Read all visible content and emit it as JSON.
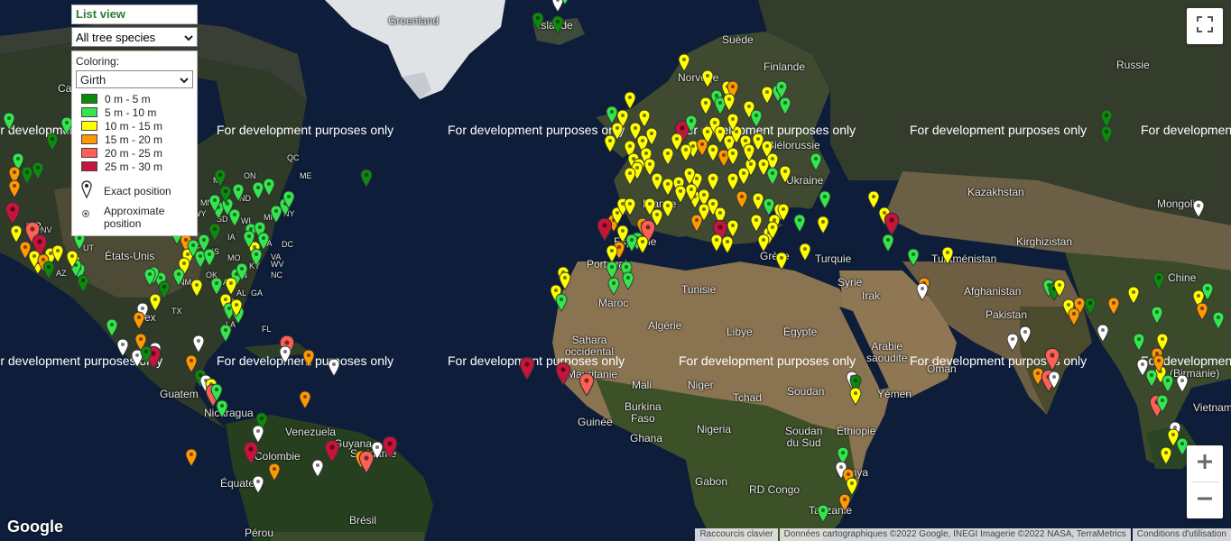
{
  "panel": {
    "list_view": "List view",
    "species_selected": "All tree species",
    "coloring_label": "Coloring:",
    "coloring_selected": "Girth",
    "legend": [
      {
        "label": "0 m - 5 m",
        "color": "#0b8a0b"
      },
      {
        "label": "5 m - 10 m",
        "color": "#33e64d"
      },
      {
        "label": "10 m - 15 m",
        "color": "#ffff00"
      },
      {
        "label": "15 m - 20 m",
        "color": "#ff9900"
      },
      {
        "label": "20 m - 25 m",
        "color": "#ff6055"
      },
      {
        "label": "25 m - 30 m",
        "color": "#c8143c"
      }
    ],
    "exact_position": "Exact position",
    "approx_position": "Approximate position"
  },
  "watermark": "For development purposes only",
  "places": {
    "groenland": "Groenland",
    "islande": "Islande",
    "suede": "Suède",
    "finlande": "Finlande",
    "norvege": "Norvège",
    "russie": "Russie",
    "bielorussie": "Biélorussie",
    "ukraine": "Ukraine",
    "france": "France",
    "kazakhstan": "Kazakhstan",
    "mongolie": "Mongolie",
    "kirghizistan": "Kirghizistan",
    "turkmenistan": "Turkménistan",
    "turquie": "Turquie",
    "grece": "Grèce",
    "espagne": "Espagne",
    "portugal": "Portugal",
    "maroc": "Maroc",
    "tunisie": "Tunisie",
    "algerie": "Algérie",
    "libye": "Libye",
    "egypte": "Égypte",
    "syrie": "Syrie",
    "irak": "Irak",
    "afghanistan": "Afghanistan",
    "pakistan": "Pakistan",
    "chine": "Chine",
    "sahara": "Sahara\noccidental",
    "mauritanie": "Mauritanie",
    "mali": "Mali",
    "niger": "Niger",
    "tchad": "Tchad",
    "soudan": "Soudan",
    "arabie": "Arabie\nsaoudite",
    "oman": "Oman",
    "yemen": "Yémen",
    "burkina": "Burkina\nFaso",
    "guinee": "Guinée",
    "ghana": "Ghana",
    "nigeria": "Nigeria",
    "soudan_sud": "Soudan\ndu Sud",
    "ethiopie": "Éthiopie",
    "kenya": "Kenya",
    "rdcongo": "RD Congo",
    "gabon": "Gabon",
    "tanzanie": "Tanzanie",
    "etats_unis": "États-Unis",
    "venezuela": "Venezuela",
    "colombie": "Colombie",
    "guyana": "Guyana",
    "suriname": "Suriname",
    "equateur": "Équateur",
    "perou": "Pérou",
    "bresil": "Brésil",
    "nicaragua": "Nicaragua",
    "guatemala": "Guatem",
    "birmanie": "(Birmanie)",
    "vietnam": "Vietnam",
    "can": "Ca",
    "or": "OR",
    "mexico": "Mex"
  },
  "map_labels_short": [
    "MT",
    "ND",
    "MN",
    "WI",
    "MI",
    "NY",
    "WY",
    "SD",
    "IA",
    "PA",
    "CO",
    "KS",
    "MO",
    "KY",
    "VA",
    "OK",
    "AR",
    "TN",
    "NC",
    "NM",
    "TX",
    "MS",
    "AL",
    "GA",
    "ME",
    "ON",
    "QC",
    "NV",
    "UT",
    "AZ",
    "LA",
    "FL",
    "WV",
    "DC"
  ],
  "google": "Google",
  "attribution": {
    "shortcuts": "Raccourcis clavier",
    "data": "Données cartographiques ©2022 Google, INEGI Imagerie ©2022 NASA, TerraMetrics",
    "terms": "Conditions d'utilisation"
  }
}
